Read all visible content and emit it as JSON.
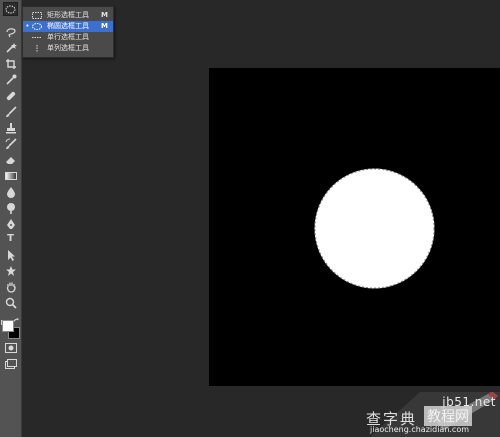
{
  "tools_panel": {
    "marquee_flyout": {
      "items": [
        {
          "label": "矩形选框工具",
          "shortcut": "M",
          "icon": "rect-marquee-icon"
        },
        {
          "label": "椭圆选框工具",
          "shortcut": "M",
          "icon": "ellipse-marquee-icon",
          "selected": true
        },
        {
          "label": "单行选框工具",
          "shortcut": "",
          "icon": "single-row-marquee-icon"
        },
        {
          "label": "单列选框工具",
          "shortcut": "",
          "icon": "single-column-marquee-icon"
        }
      ]
    },
    "type_tool_glyph": "T",
    "foreground_color": "#ffffff",
    "background_color": "#000000"
  },
  "document": {
    "canvas_color": "#000000",
    "selection_shape": "circle",
    "selection_fill": "#ffffff"
  },
  "watermark": {
    "site": "jb51.net",
    "brand_left": "查字典",
    "brand_right": "教程网",
    "url": "jiaocheng.chazidian.com"
  },
  "colors": {
    "workspace": "#282828",
    "toolbar": "#535353",
    "flyout_bg": "#4a4a4a",
    "flyout_selected": "#3b6fd0"
  }
}
